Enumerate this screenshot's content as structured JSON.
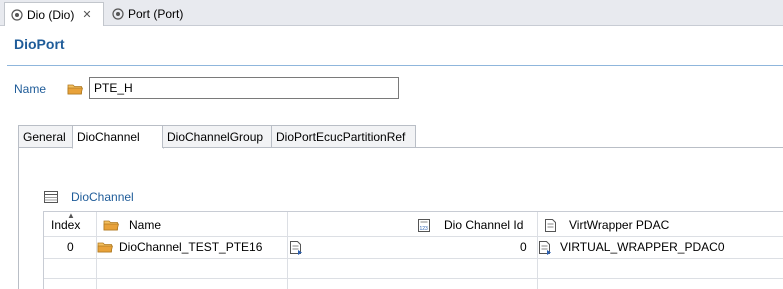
{
  "editor_tabs": [
    {
      "label": "Dio (Dio)",
      "active": true
    },
    {
      "label": "Port (Port)",
      "active": false
    }
  ],
  "page_title": "DioPort",
  "name_field": {
    "label": "Name",
    "value": "PTE_H"
  },
  "section_tabs": [
    {
      "label": "General",
      "active": false
    },
    {
      "label": "DioChannel",
      "active": true
    },
    {
      "label": "DioChannelGroup",
      "active": false
    },
    {
      "label": "DioPortEcucPartitionRef",
      "active": false
    }
  ],
  "table": {
    "title": "DioChannel",
    "columns": [
      "Index",
      "Name",
      "Dio Channel Id",
      "VirtWrapper PDAC"
    ],
    "rows": [
      {
        "index": "0",
        "name": "DioChannel_TEST_PTE16",
        "channel_id": "0",
        "virtwrapper": "VIRTUAL_WRAPPER_PDAC0"
      }
    ]
  },
  "colors": {
    "accent": "#1f5c99",
    "folder": "#e8a23a",
    "divider": "#8fb6dc"
  },
  "icons": [
    "dio-editor-icon",
    "close-icon",
    "port-editor-icon",
    "folder-icon",
    "table-icon",
    "number-field-icon",
    "reference-icon"
  ]
}
